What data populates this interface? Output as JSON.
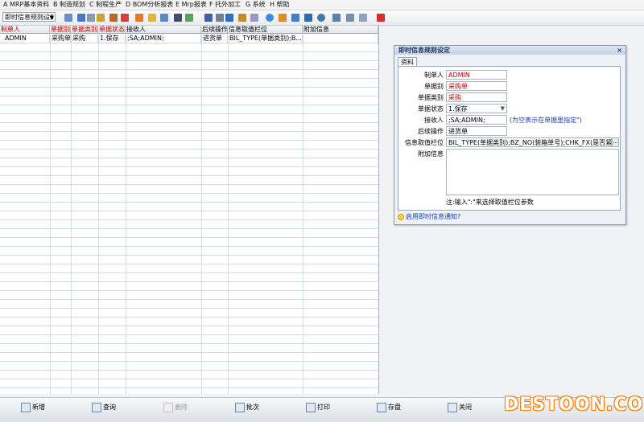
{
  "menu": [
    "A MRP基本资料",
    "B 制造规划",
    "C 制程生产",
    "D BOM分析报表",
    "E Mrp报表",
    "F 托外加工",
    "G 系统",
    "H 帮助"
  ],
  "toolbar": {
    "combo_value": "即时信息规则设5"
  },
  "grid": {
    "headers": [
      "制单人",
      "单据别",
      "单据类别",
      "单据状态",
      "接收人",
      "后续操作",
      "信息取值栏位",
      "附加信息"
    ],
    "rows": [
      [
        "ADMIN",
        "采购单",
        "采购",
        "1.保存",
        ";SA;ADMIN;",
        "进货单",
        "BIL_TYPE(单据类别);B...",
        ""
      ]
    ]
  },
  "panel": {
    "title": "即时信息规则设定",
    "close_label": "×",
    "tab": "资料",
    "fields": {
      "creator_label": "制单人",
      "creator_value": "ADMIN",
      "doc_label": "单据别",
      "doc_value": "采购单",
      "doctype_label": "单据类别",
      "doctype_value": "采购",
      "status_label": "单据状态",
      "status_value": "1.保存",
      "receiver_label": "接收人",
      "receiver_value": ";SA;ADMIN;",
      "receiver_hint": "(为空表示在单据里指定\")",
      "followup_label": "后续操作",
      "followup_value": "进货单",
      "fieldpick_label": "信息取值栏位",
      "fieldpick_value": "BIL_TYPE(单据类别);BZ_NO(装箱单号);CHK_FX(是否紧急)",
      "extra_label": "附加信息",
      "note": "注:输入\":\"来选择取值栏位参数"
    },
    "enable_link": "启用即时信息通知?"
  },
  "bottom_buttons": [
    "新增",
    "查询",
    "删除",
    "批次",
    "打印",
    "存盘",
    "关闭"
  ],
  "watermark": "DESTOON.COM"
}
